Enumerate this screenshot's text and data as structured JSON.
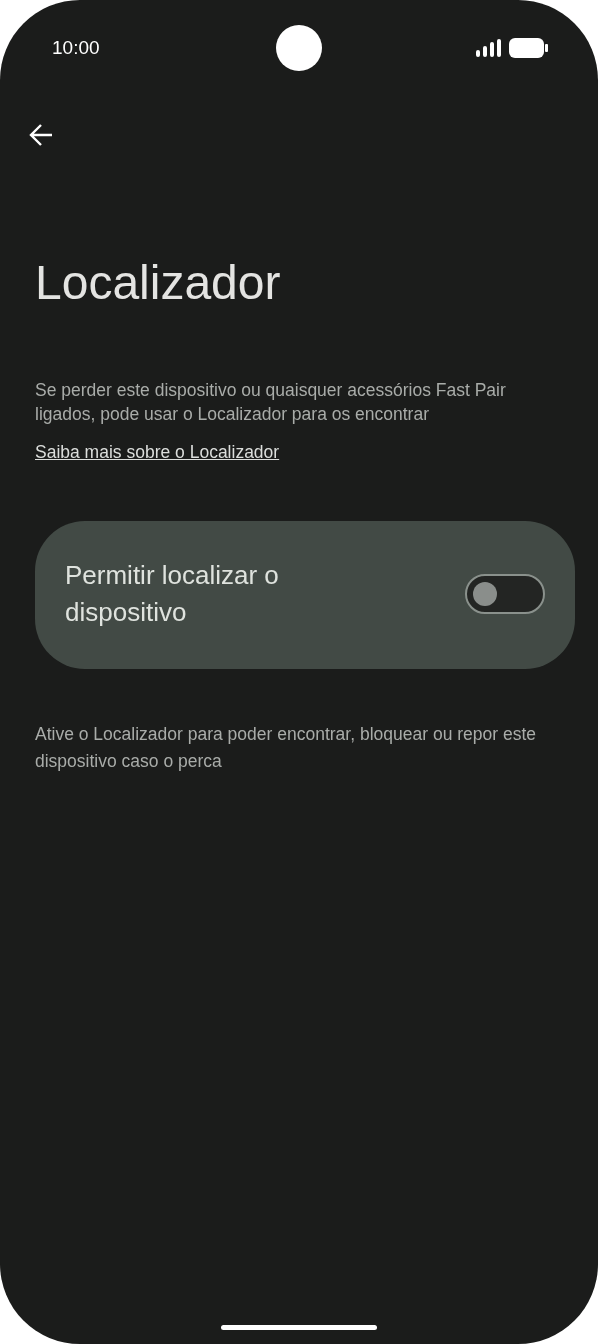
{
  "status_bar": {
    "time": "10:00"
  },
  "title": "Localizador",
  "description": "Se perder este dispositivo ou quaisquer acessórios Fast Pair ligados, pode usar o Localizador para os encontrar",
  "link": "Saiba mais sobre o Localizador",
  "setting": {
    "label": "Permitir localizar o dispositivo",
    "on": false
  },
  "footer": "Ative o Localizador para poder encontrar, bloquear ou repor este dispositivo caso o perca"
}
